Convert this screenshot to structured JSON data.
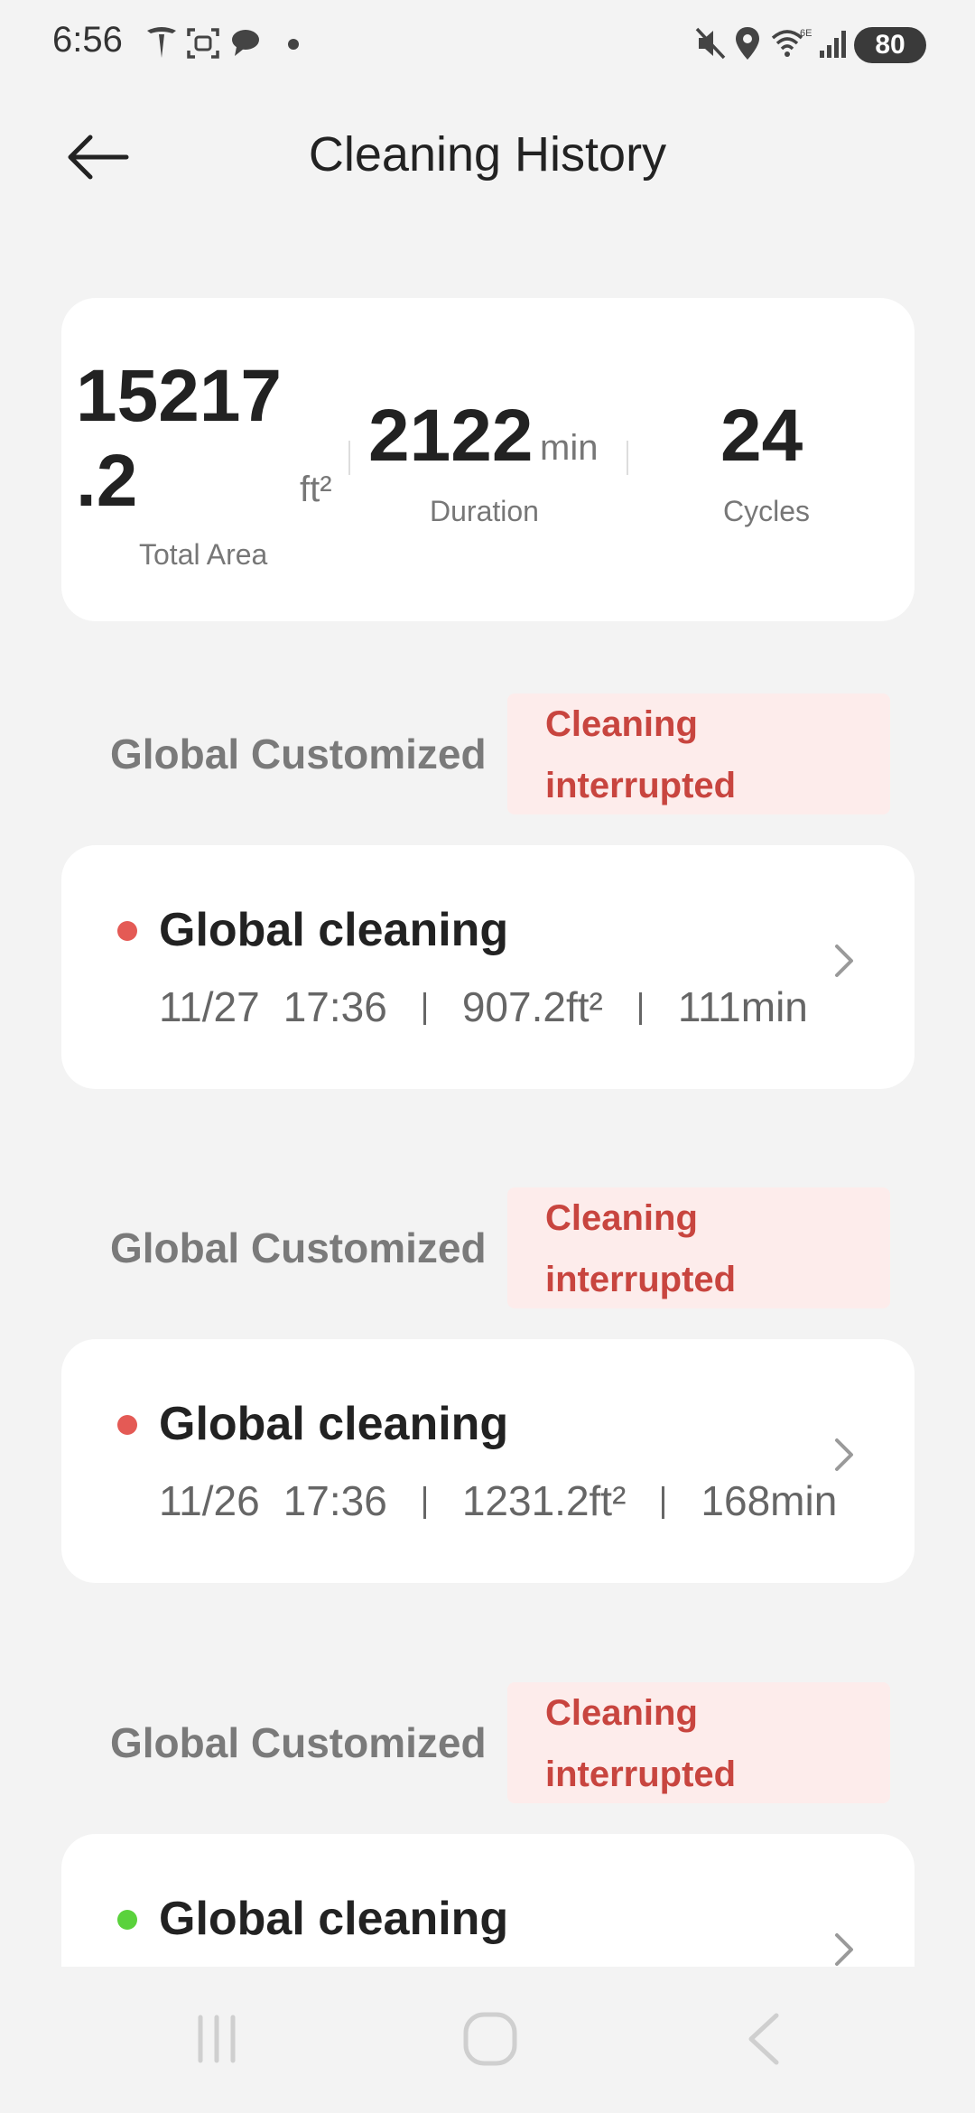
{
  "status_bar": {
    "time": "6:56",
    "battery": "80"
  },
  "header": {
    "title": "Cleaning History"
  },
  "summary": {
    "total_area_value": "15217.2",
    "total_area_line1": "15217",
    "total_area_line2": ".2",
    "total_area_unit": "ft²",
    "total_area_label": "Total Area",
    "duration_value": "2122",
    "duration_unit": "min",
    "duration_label": "Duration",
    "cycles_value": "24",
    "cycles_label": "Cycles"
  },
  "records": [
    {
      "group_label": "Global Customized",
      "status_line1": "Cleaning",
      "status_line2": "interrupted",
      "title": "Global cleaning",
      "date": "11/27",
      "time": "17:36",
      "area": "907.2ft²",
      "duration": "111min",
      "dot_color": "#e45a55"
    },
    {
      "group_label": "Global Customized",
      "status_line1": "Cleaning",
      "status_line2": "interrupted",
      "title": "Global cleaning",
      "date": "11/26",
      "time": "17:36",
      "area": "1231.2ft²",
      "duration": "168min",
      "dot_color": "#e45a55"
    },
    {
      "group_label": "Global Customized",
      "status_line1": "Cleaning",
      "status_line2": "interrupted",
      "title": "Global cleaning",
      "dot_color": "#5ad23c"
    }
  ],
  "colors": {
    "background": "#f3f3f3",
    "card": "#ffffff",
    "badge_bg": "#fdeceb",
    "badge_text": "#c8453f"
  }
}
